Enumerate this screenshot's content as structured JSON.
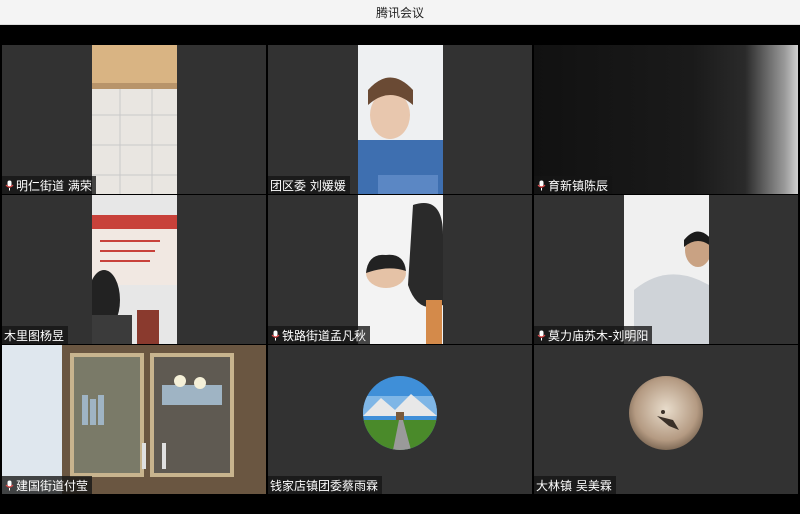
{
  "window": {
    "title": "腾讯会议"
  },
  "participants": [
    {
      "name": "明仁街道 满荣",
      "mic_icon": "mic-icon"
    },
    {
      "name": "团区委 刘媛媛",
      "mic_icon": ""
    },
    {
      "name": "育新镇陈辰",
      "mic_icon": "mic-icon"
    },
    {
      "name": "木里图杨昱",
      "mic_icon": ""
    },
    {
      "name": "铁路街道孟凡秋",
      "mic_icon": "mic-icon"
    },
    {
      "name": "莫力庙苏木-刘明阳",
      "mic_icon": "mic-icon"
    },
    {
      "name": "建国街道付莹",
      "mic_icon": "mic-icon"
    },
    {
      "name": "钱家店镇团委蔡雨霖",
      "mic_icon": ""
    },
    {
      "name": "大林镇 吴美霖",
      "mic_icon": ""
    }
  ],
  "colors": {
    "tile_bg": "#323232",
    "label_bg": "#141414",
    "window_bg": "#000000"
  }
}
